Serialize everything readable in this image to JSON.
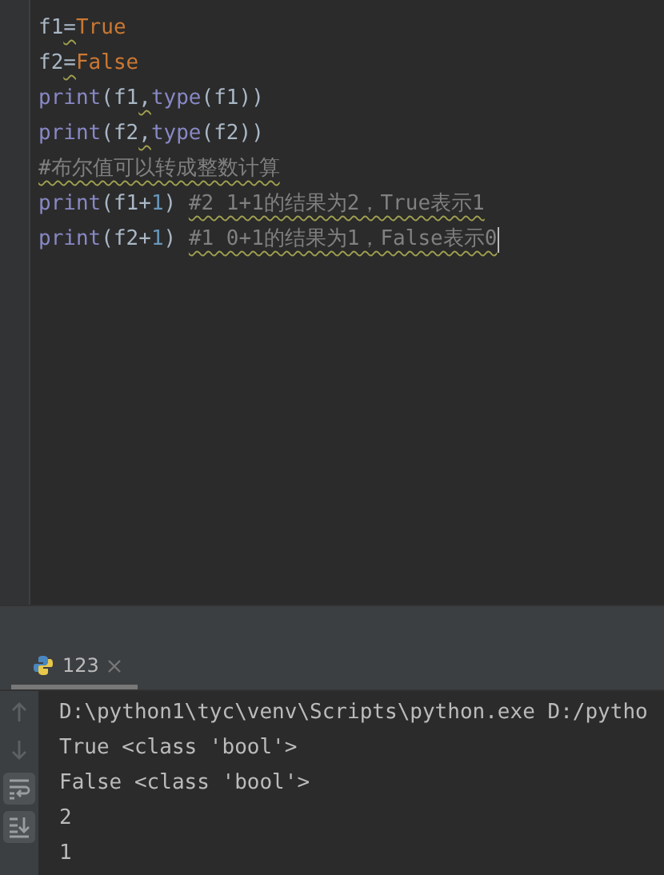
{
  "editor": {
    "lines": [
      {
        "tokens": [
          {
            "text": "f1",
            "kind": "ident"
          },
          {
            "text": "=",
            "kind": "op",
            "warning": true
          },
          {
            "text": "True",
            "kind": "keyword"
          }
        ]
      },
      {
        "tokens": [
          {
            "text": "f2",
            "kind": "ident"
          },
          {
            "text": "=",
            "kind": "op",
            "warning": true
          },
          {
            "text": "False",
            "kind": "keyword"
          }
        ]
      },
      {
        "tokens": [
          {
            "text": "print",
            "kind": "builtin"
          },
          {
            "text": "(f1",
            "kind": "ident"
          },
          {
            "text": ",",
            "kind": "op",
            "warning": true
          },
          {
            "text": "type",
            "kind": "builtin"
          },
          {
            "text": "(f1))",
            "kind": "ident"
          }
        ]
      },
      {
        "tokens": [
          {
            "text": "print",
            "kind": "builtin"
          },
          {
            "text": "(f2",
            "kind": "ident"
          },
          {
            "text": ",",
            "kind": "op",
            "warning": true
          },
          {
            "text": "type",
            "kind": "builtin"
          },
          {
            "text": "(f2))",
            "kind": "ident"
          }
        ]
      },
      {
        "tokens": [
          {
            "text": "#布尔值可以转成整数计算",
            "kind": "comment",
            "warning": true
          }
        ]
      },
      {
        "tokens": [
          {
            "text": "print",
            "kind": "builtin"
          },
          {
            "text": "(f1+",
            "kind": "ident"
          },
          {
            "text": "1",
            "kind": "number"
          },
          {
            "text": ") ",
            "kind": "ident"
          },
          {
            "text": "#2 1+1的结果为2，True表示1",
            "kind": "comment",
            "warning": true
          }
        ]
      },
      {
        "tokens": [
          {
            "text": "print",
            "kind": "builtin"
          },
          {
            "text": "(f2+",
            "kind": "ident"
          },
          {
            "text": "1",
            "kind": "number"
          },
          {
            "text": ") ",
            "kind": "ident"
          },
          {
            "text": "#1 0+1的结果为1，False表示0",
            "kind": "comment",
            "warning": true
          }
        ],
        "caret": true
      }
    ]
  },
  "run_panel": {
    "tab": {
      "label": "123",
      "selected": true
    },
    "tools": [
      {
        "kind": "up",
        "selected": false
      },
      {
        "kind": "down",
        "selected": false
      },
      {
        "kind": "wrap",
        "selected": true
      },
      {
        "kind": "scroll-end",
        "selected": true
      }
    ],
    "output": [
      "D:\\python1\\tyc\\venv\\Scripts\\python.exe D:/pytho",
      "True <class 'bool'>",
      "False <class 'bool'>",
      "2",
      "1"
    ]
  }
}
